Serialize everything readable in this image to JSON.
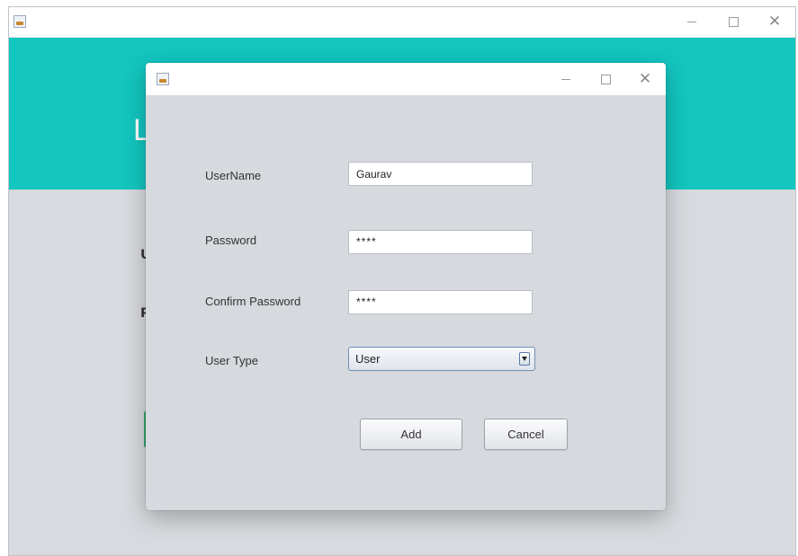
{
  "background_window": {
    "header_title": "L",
    "side_labels": [
      "U",
      "P"
    ],
    "header_color": "#13c6bf"
  },
  "dialog": {
    "title": "",
    "fields": {
      "username": {
        "label": "UserName",
        "value": "Gaurav"
      },
      "password": {
        "label": "Password",
        "value": "****"
      },
      "confirm_password": {
        "label": "Confirm Password",
        "value": "****"
      }
    },
    "user_type": {
      "label": "User Type",
      "selected": "User"
    },
    "buttons": {
      "add": "Add",
      "cancel": "Cancel"
    }
  },
  "icons": {
    "app": "java-app-icon",
    "minimize": "minimize-icon",
    "maximize": "maximize-icon",
    "close": "close-icon",
    "dropdown": "chevron-down-icon"
  }
}
